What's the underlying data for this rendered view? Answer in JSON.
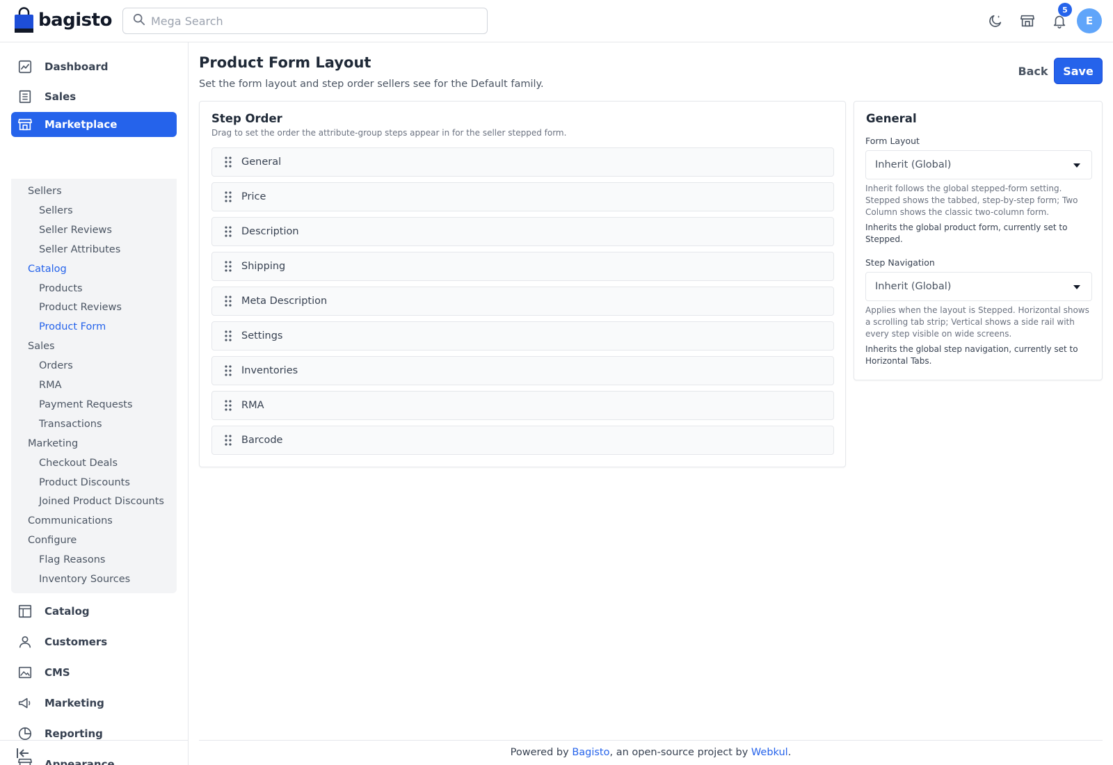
{
  "header": {
    "brand": "bagisto",
    "search_placeholder": "Mega Search",
    "notification_count": "5",
    "avatar_initial": "E",
    "icons": [
      "moon-icon",
      "store-icon",
      "bell-icon"
    ]
  },
  "sidebar": {
    "top_items": [
      {
        "label": "Dashboard",
        "icon": "dashboard-icon"
      },
      {
        "label": "Sales",
        "icon": "receipt-icon"
      },
      {
        "label": "Marketplace",
        "icon": "store-icon",
        "active": true
      }
    ],
    "marketplace_menu": [
      {
        "label": "Sellers",
        "level": 1
      },
      {
        "label": "Sellers",
        "level": 2
      },
      {
        "label": "Seller Reviews",
        "level": 2
      },
      {
        "label": "Seller Attributes",
        "level": 2
      },
      {
        "label": "Catalog",
        "level": 1,
        "highlighted": true
      },
      {
        "label": "Products",
        "level": 2
      },
      {
        "label": "Product Reviews",
        "level": 2
      },
      {
        "label": "Product Form",
        "level": 2,
        "highlighted": true
      },
      {
        "label": "Sales",
        "level": 1
      },
      {
        "label": "Orders",
        "level": 2
      },
      {
        "label": "RMA",
        "level": 2
      },
      {
        "label": "Payment Requests",
        "level": 2
      },
      {
        "label": "Transactions",
        "level": 2
      },
      {
        "label": "Marketing",
        "level": 1
      },
      {
        "label": "Checkout Deals",
        "level": 2
      },
      {
        "label": "Product Discounts",
        "level": 2
      },
      {
        "label": "Joined Product Discounts",
        "level": 2
      },
      {
        "label": "Communications",
        "level": 1
      },
      {
        "label": "Configure",
        "level": 1
      },
      {
        "label": "Flag Reasons",
        "level": 2
      },
      {
        "label": "Inventory Sources",
        "level": 2
      }
    ],
    "bottom_items": [
      {
        "label": "Catalog",
        "icon": "catalog-icon"
      },
      {
        "label": "Customers",
        "icon": "user-icon"
      },
      {
        "label": "CMS",
        "icon": "image-icon"
      },
      {
        "label": "Marketing",
        "icon": "megaphone-icon"
      },
      {
        "label": "Reporting",
        "icon": "pie-chart-icon"
      },
      {
        "label": "Appearance",
        "icon": "store-icon"
      }
    ]
  },
  "page": {
    "title": "Product Form Layout",
    "subtitle": "Set the form layout and step order sellers see for the Default family.",
    "back_label": "Back",
    "save_label": "Save"
  },
  "step_order": {
    "title": "Step Order",
    "description": "Drag to set the order the attribute-group steps appear in for the seller stepped form.",
    "steps": [
      "General",
      "Price",
      "Description",
      "Shipping",
      "Meta Description",
      "Settings",
      "Inventories",
      "RMA",
      "Barcode"
    ]
  },
  "general": {
    "title": "General",
    "form_layout": {
      "label": "Form Layout",
      "value": "Inherit (Global)",
      "help": "Inherit follows the global stepped-form setting. Stepped shows the tabbed, step-by-step form; Two Column shows the classic two-column form.",
      "note": "Inherits the global product form, currently set to Stepped."
    },
    "step_navigation": {
      "label": "Step Navigation",
      "value": "Inherit (Global)",
      "help": "Applies when the layout is Stepped. Horizontal shows a scrolling tab strip; Vertical shows a side rail with every step visible on wide screens.",
      "note": "Inherits the global step navigation, currently set to Horizontal Tabs."
    }
  },
  "footer": {
    "prefix": "Powered by ",
    "link1": "Bagisto",
    "middle": ", an open-source project by ",
    "link2": "Webkul",
    "suffix": "."
  },
  "colors": {
    "accent": "#2563eb",
    "text": "#1f2937",
    "muted": "#6b7280",
    "border": "#e5e7eb",
    "submenu_bg": "#f3f4f6"
  }
}
